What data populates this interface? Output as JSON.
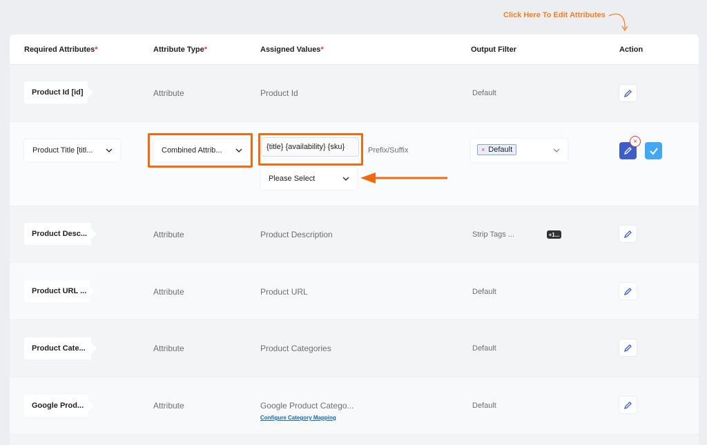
{
  "hint": {
    "text": "Click Here To Edit Attributes"
  },
  "columns": {
    "required": "Required Attributes",
    "type": "Attribute Type",
    "assigned": "Assigned Values",
    "filter": "Output Filter",
    "action": "Action",
    "required_mark": "*"
  },
  "rows": [
    {
      "tag": "Product Id [id]",
      "type": "Attribute",
      "value": "Product Id",
      "filter": "Default"
    },
    {
      "tag": "Product Title [titl...",
      "type": "Combined Attrib...",
      "value": "{title} {availability} {sku}",
      "prefix_suffix": "Prefix/Suffix",
      "please_select": "Please Select",
      "filter_chip": "Default",
      "filter_chip_remove": "×",
      "remove_badge": "×"
    },
    {
      "tag": "Product Desc...",
      "type": "Attribute",
      "value": "Product Description",
      "filter": "Strip Tags ...",
      "filter_badge": "+1..."
    },
    {
      "tag": "Product URL ...",
      "type": "Attribute",
      "value": "Product URL",
      "filter": "Default"
    },
    {
      "tag": "Product Cate...",
      "type": "Attribute",
      "value": "Product Categories",
      "filter": "Default"
    },
    {
      "tag": "Google Prod...",
      "type": "Attribute",
      "value": "Google Product Catego...",
      "link": "Configure Category Mapping",
      "filter": "Default"
    }
  ],
  "colors": {
    "accent_orange": "#f26a10",
    "hint_orange": "#f47f24",
    "edit_blue": "#3d5dc7",
    "confirm_blue": "#44a7f2",
    "required_red": "#e53935"
  }
}
